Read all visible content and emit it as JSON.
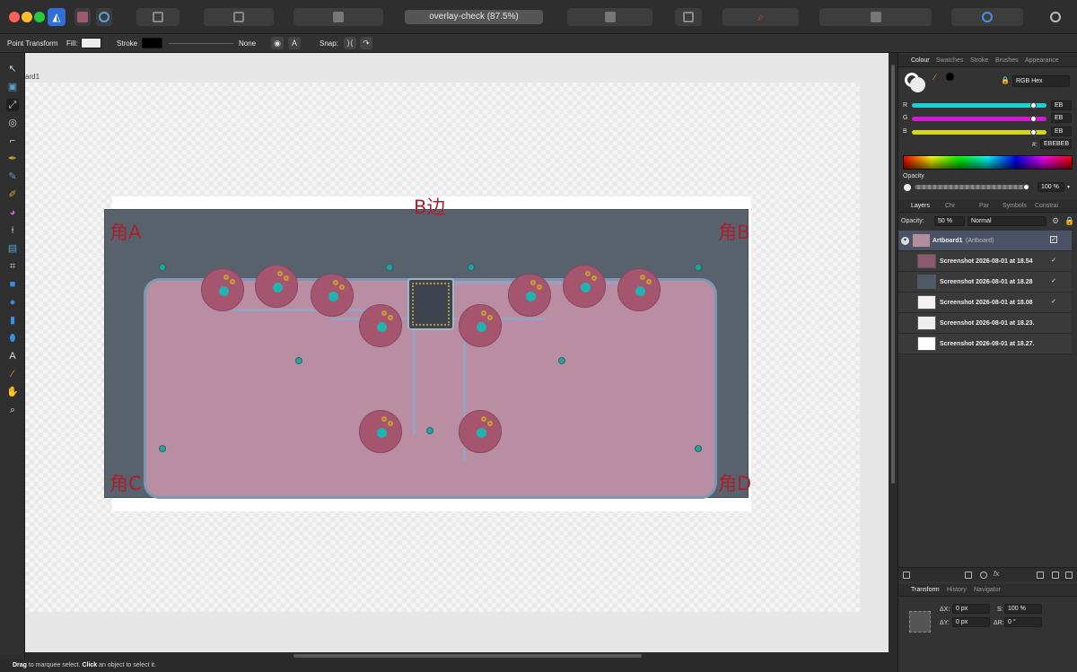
{
  "window": {
    "document_title": "overlay-check (87.5%)"
  },
  "context_toolbar": {
    "tool_name": "Point Transform",
    "fill_label": "Fill:",
    "stroke_label": "Stroke",
    "stroke_value": "None",
    "snap_label": "Snap:"
  },
  "canvas": {
    "artboard_label": "ard1",
    "labels": {
      "edge_b": "B边",
      "corner_a": "角A",
      "corner_b": "角B",
      "corner_c": "角C",
      "corner_d": "角D"
    }
  },
  "status_bar": {
    "drag_word": "Drag",
    "drag_text": " to marquee select. ",
    "click_word": "Click",
    "click_text": " an object to select it."
  },
  "colour_panel": {
    "tabs": [
      "Colour",
      "Swatches",
      "Stroke",
      "Brushes",
      "Appearance"
    ],
    "mode": "RGB Hex",
    "r_label": "R",
    "r_value": "EB",
    "g_label": "G",
    "g_value": "EB",
    "b_label": "B",
    "b_value": "EB",
    "hex_label": "#:",
    "hex_value": "EBEBEB",
    "opacity_label": "Opacity",
    "opacity_value": "100 %",
    "colors": {
      "r_track": "#19d3d3",
      "g_track": "#d019d0",
      "b_track": "#d6d619"
    }
  },
  "layers_panel": {
    "tabs": [
      "Layers",
      "Chr",
      "Par",
      "Symbols",
      "Constrai"
    ],
    "opacity_label": "Opacity:",
    "opacity_value": "50 %",
    "blend_mode": "Normal",
    "artboard_name": "Artboard1",
    "artboard_kind": "(Artboard)",
    "layers": [
      {
        "name": "Screenshot 2026-08-01 at 18.54",
        "checked": "✓"
      },
      {
        "name": "Screenshot 2026-08-01 at 18.28",
        "checked": "✓"
      },
      {
        "name": "Screenshot 2026-08-01 at 18.08",
        "checked": "✓"
      },
      {
        "name": "Screenshot 2026-08-01 at 18.23.",
        "checked": ""
      },
      {
        "name": "Screenshot 2026-08-01 at 18.27.",
        "checked": ""
      }
    ]
  },
  "transform_panel": {
    "tabs": [
      "Transform",
      "History",
      "Navigator"
    ],
    "dx_label": "ΔX:",
    "dx_value": "0 px",
    "dy_label": "ΔY:",
    "dy_value": "0 px",
    "s_label": "S:",
    "s_value": "100 %",
    "r_label": "ΔR:",
    "r_value": "0 °"
  }
}
